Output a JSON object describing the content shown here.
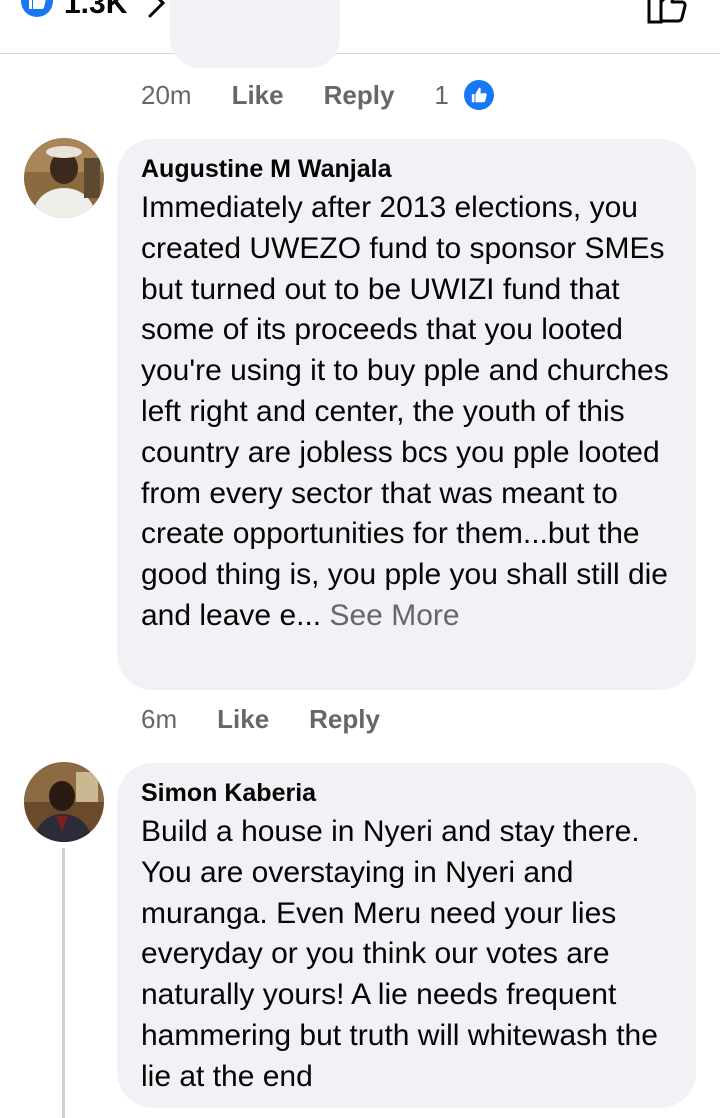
{
  "header": {
    "reaction_count": "1.3K",
    "like_icon": "thumbs-up-icon",
    "chevron_icon": "chevron-right-icon",
    "share_icon": "share-icon",
    "accent": "#1877f2"
  },
  "prev_comment": {
    "time": "20m",
    "like_label": "Like",
    "reply_label": "Reply",
    "reaction_count": "1"
  },
  "comments": [
    {
      "author": "Augustine M Wanjala",
      "text": "Immediately after 2013 elections, you created UWEZO fund to sponsor SMEs but turned out to be UWIZI fund that some of its proceeds that you looted you're using it to buy pple and churches left right and center, the youth of this country are jobless bcs you pple looted from every sector that was meant to create opportunities for them...but the good thing is, you pple you shall still die and leave e...",
      "see_more": "See More",
      "time": "6m",
      "like_label": "Like",
      "reply_label": "Reply"
    },
    {
      "author": "Simon Kaberia",
      "text": "Build a house in Nyeri and stay there. You are overstaying in Nyeri and muranga. Even Meru need your lies everyday or you think our votes are naturally yours! A lie needs frequent hammering but truth will whitewash the lie at the end"
    }
  ]
}
